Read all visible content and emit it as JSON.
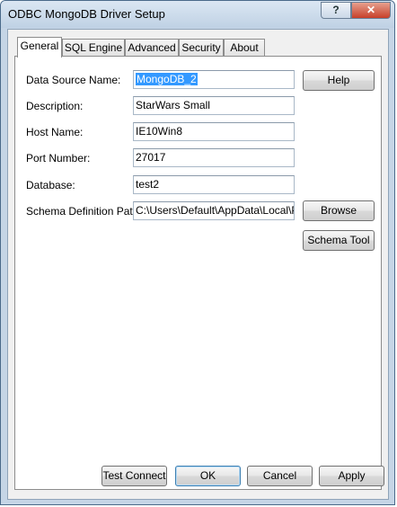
{
  "window": {
    "title": "ODBC MongoDB Driver Setup",
    "help_glyph": "?",
    "close_glyph": "✕"
  },
  "tabs": [
    {
      "label": "General"
    },
    {
      "label": "SQL Engine"
    },
    {
      "label": "Advanced"
    },
    {
      "label": "Security"
    },
    {
      "label": "About"
    }
  ],
  "form": {
    "data_source_name": {
      "label": "Data Source Name:",
      "value": "MongoDB_2"
    },
    "description": {
      "label": "Description:",
      "value": "StarWars Small"
    },
    "host_name": {
      "label": "Host Name:",
      "value": "IE10Win8"
    },
    "port_number": {
      "label": "Port Number:",
      "value": "27017"
    },
    "database": {
      "label": "Database:",
      "value": "test2"
    },
    "schema_definition_path": {
      "label": "Schema Definition Path:",
      "value": "C:\\Users\\Default\\AppData\\Local\\Pr"
    }
  },
  "buttons": {
    "help": "Help",
    "browse": "Browse",
    "schema_tool": "Schema Tool",
    "test_connect": "Test Connect",
    "ok": "OK",
    "cancel": "Cancel",
    "apply": "Apply"
  },
  "colors": {
    "title_gradient_top": "#dbe7f3",
    "close_button": "#c7402a",
    "selection": "#3399ff"
  }
}
